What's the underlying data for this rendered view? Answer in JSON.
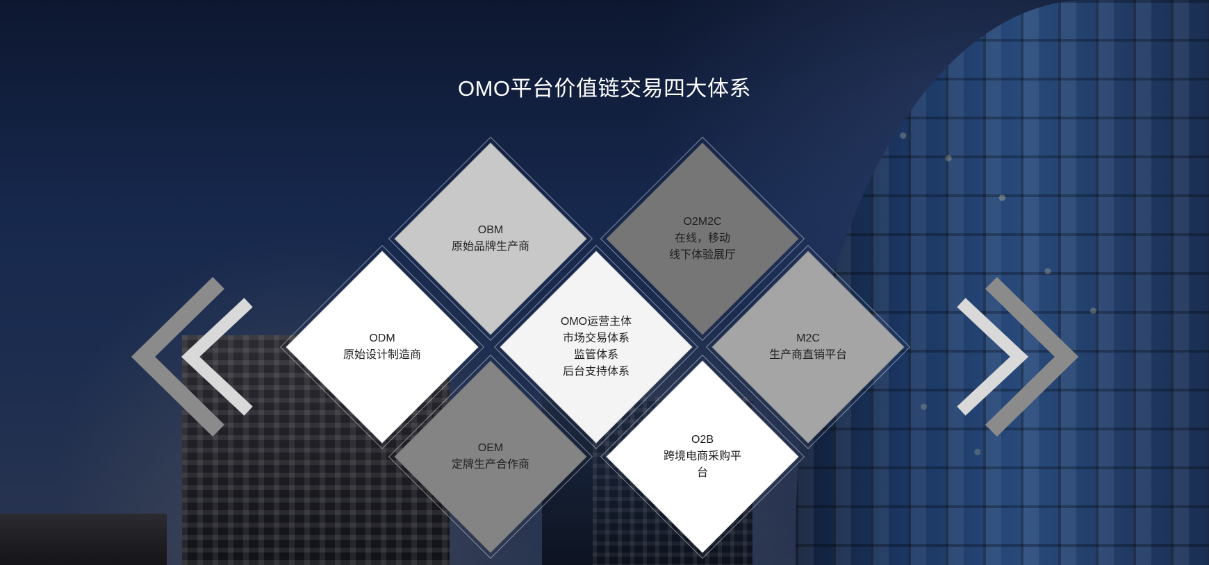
{
  "title": "OMO平台价值链交易四大体系",
  "navigation": {
    "left_icon": "double-chevron-left-icon",
    "right_icon": "double-chevron-right-icon",
    "colors": {
      "dark_arrow": "#8b8b8b",
      "light_arrow": "#d9d9d9"
    }
  },
  "diamonds": [
    {
      "key": "obm",
      "title": "OBM",
      "lines": [
        "原始品牌生产商"
      ],
      "color": "#c8c8c8"
    },
    {
      "key": "o2m2c",
      "title": "O2M2C",
      "lines": [
        "在线，移动",
        "线下体验展厅"
      ],
      "color": "#767676"
    },
    {
      "key": "odm",
      "title": "ODM",
      "lines": [
        "原始设计制造商"
      ],
      "color": "#ffffff"
    },
    {
      "key": "center",
      "title": "OMO运营主体",
      "lines": [
        "市场交易体系",
        "监管体系",
        "后台支持体系"
      ],
      "color": "#f4f4f4"
    },
    {
      "key": "m2c",
      "title": "M2C",
      "lines": [
        "生产商直销平台"
      ],
      "color": "#a5a5a5"
    },
    {
      "key": "oem",
      "title": "OEM",
      "lines": [
        "定牌生产合作商"
      ],
      "color": "#848484"
    },
    {
      "key": "o2b",
      "title": "O2B",
      "lines": [
        "跨境电商采购平",
        "台"
      ],
      "color": "#ffffff"
    }
  ]
}
